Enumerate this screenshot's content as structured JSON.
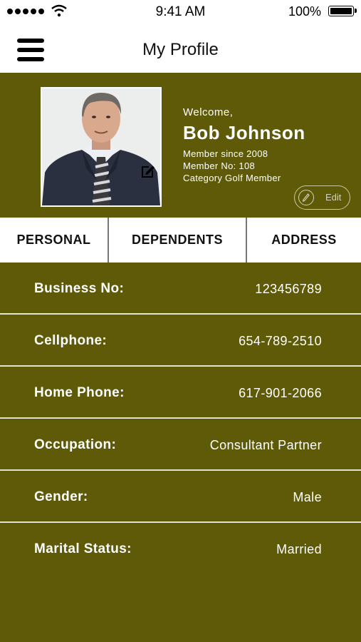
{
  "status_bar": {
    "time": "9:41 AM",
    "battery": "100%"
  },
  "header": {
    "title": "My Profile"
  },
  "profile": {
    "welcome": "Welcome,",
    "name": "Bob Johnson",
    "member_since": "Member since 2008",
    "member_no": "Member No: 108",
    "category": "Category Golf Member",
    "edit_label": "Edit"
  },
  "tabs": [
    {
      "label": "PERSONAL"
    },
    {
      "label": "DEPENDENTS"
    },
    {
      "label": "ADDRESS"
    }
  ],
  "details": [
    {
      "label": "Business No:",
      "value": "123456789"
    },
    {
      "label": "Cellphone:",
      "value": "654-789-2510"
    },
    {
      "label": "Home Phone:",
      "value": "617-901-2066"
    },
    {
      "label": "Occupation:",
      "value": "Consultant Partner"
    },
    {
      "label": "Gender:",
      "value": "Male"
    },
    {
      "label": "Marital Status:",
      "value": "Married"
    }
  ],
  "colors": {
    "accent": "#5e5a08",
    "divider": "#e4e2cf",
    "header_bg": "#ffffff"
  },
  "icons": {
    "menu": "hamburger-menu-icon",
    "edit_photo": "edit-square-icon",
    "edit_button": "pencil-icon"
  }
}
